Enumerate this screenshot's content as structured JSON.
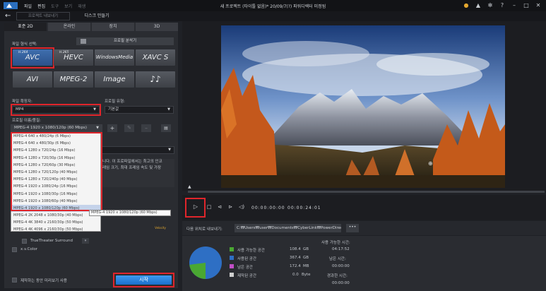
{
  "app": {
    "title": "새 프로젝트 (타이틀 없음)* 20/09/7(?) 파워디렉터 미정됨",
    "menu": [
      "파일",
      "편집",
      "도구",
      "보기",
      "재생"
    ]
  },
  "topbar": {
    "tab_produce": "프로젝트 내보내기",
    "tab_disc": "디스크 만들기"
  },
  "produce_tabs": [
    "표준 2D",
    "온라인",
    "장치",
    "3D"
  ],
  "left": {
    "format_label": "파일 형식 선택:",
    "analyzer_label": "프로필 분석기",
    "formats": [
      {
        "label": "AVC",
        "sup": "H.264"
      },
      {
        "label": "HEVC",
        "sup": "H.265"
      },
      {
        "label": "WindowsMedia",
        "sup": ""
      },
      {
        "label": "XAVC S",
        "sup": ""
      },
      {
        "label": "AVI",
        "sup": ""
      },
      {
        "label": "MPEG-2",
        "sup": ""
      },
      {
        "label": "Image",
        "sup": ""
      },
      {
        "label": "♪♪",
        "sup": ""
      }
    ],
    "extension_label": "파일 확장자:",
    "extension_value": "MP4",
    "profile_type_label": "프로필 유형:",
    "profile_type_value": "기본값",
    "profile_name_label": "프로필 이름/품질:",
    "profile_value": "MPEG-4 1920 x 1080/120p (60 Mbps)",
    "profile_options": [
      "MPEG-4 640 x 480/24p (6 Mbps)",
      "MPEG-4 640 x 480/30p (6 Mbps)",
      "MPEG-4 1280 x 720/24p (16 Mbps)",
      "MPEG-4 1280 x 720/30p (16 Mbps)",
      "MPEG-4 1280 x 720/60p (30 Mbps)",
      "MPEG-4 1280 x 720/120p (40 Mbps)",
      "MPEG-4 1280 x 720/240p (40 Mbps)",
      "MPEG-4 1920 x 1080/24p (16 Mbps)",
      "MPEG-4 1920 x 1080/30p (16 Mbps)",
      "MPEG-4 1920 x 1080/60p (40 Mbps)",
      "MPEG-4 1920 x 1080/120p (60 Mbps)",
      "MPEG-4 2K 2048 x 1080/30p (40 Mbps)",
      "MPEG-4 4K 3840 x 2160/30p (50 Mbps)",
      "MPEG-4 4K 4096 x 2160/30p (50 Mbps)"
    ],
    "tooltip": "MPEG-4 1920 x 1080/120p (60 Mbps)",
    "description": "니다. 이 프로파일에서는 최고의 인코",
    "description2": "레임 크기, 최대 프레임 속도 및 가장",
    "truetheater": "TrueTheater Surround",
    "xvcolor": "x.v.Color",
    "preview_while_producing": "제작하는 동안 미리보기 사용",
    "start_label": "시작"
  },
  "player": {
    "timecode": "00:00:00:00",
    "timecode_total": "00:00:24:01"
  },
  "export": {
    "label": "다음 위치로 내보내기:",
    "path": "C:₩Users₩user₩Documents₩CyberLink₩PowerDirector",
    "browse": "•••"
  },
  "storage": {
    "rows": [
      {
        "label": "사용 가능한 공간",
        "value": "108.4",
        "unit": "GB",
        "color": "#4aa832"
      },
      {
        "label": "사용된 공간",
        "value": "367.4",
        "unit": "GB",
        "color": "#2e6fc4"
      },
      {
        "label": "남은 공간",
        "value": "172.4",
        "unit": "MB",
        "color": "#c24fc6"
      },
      {
        "label": "제작된 공간",
        "value": "0.0",
        "unit": "Byte",
        "color": "#cfcfcf"
      }
    ],
    "time_available_label": "사용 가능한 시간:",
    "time_available": "04:17:52",
    "time_left_label": "남은 시간:",
    "time_left": "00:00:00",
    "time_elapsed_label": "경과한 시간:",
    "time_elapsed": "00:00:00",
    "used_fraction": 0.23
  }
}
